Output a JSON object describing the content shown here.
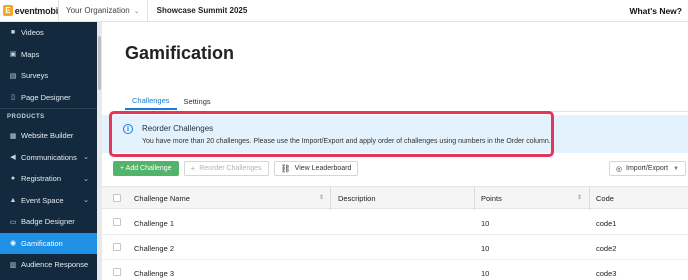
{
  "topbar": {
    "logo_text": "eventmobi",
    "org_label": "Your Organization",
    "event_name": "Showcase Summit 2025",
    "whats_new": "What's New?"
  },
  "sidebar": {
    "items_top": [
      {
        "label": "Videos",
        "icon": "video-icon"
      },
      {
        "label": "Maps",
        "icon": "map-icon"
      },
      {
        "label": "Surveys",
        "icon": "survey-icon"
      },
      {
        "label": "Page Designer",
        "icon": "page-icon"
      }
    ],
    "section_label": "PRODUCTS",
    "items_products": [
      {
        "label": "Website Builder",
        "icon": "website-icon",
        "expandable": false
      },
      {
        "label": "Communications",
        "icon": "megaphone-icon",
        "expandable": true
      },
      {
        "label": "Registration",
        "icon": "person-icon",
        "expandable": true
      },
      {
        "label": "Event Space",
        "icon": "event-space-icon",
        "expandable": true
      },
      {
        "label": "Badge Designer",
        "icon": "badge-icon",
        "expandable": false
      },
      {
        "label": "Gamification",
        "icon": "gamepad-icon",
        "expandable": false,
        "active": true
      },
      {
        "label": "Audience Response",
        "icon": "chart-icon",
        "expandable": false
      }
    ],
    "active_color": "#1e90e6",
    "bg_color": "#132a3e"
  },
  "main": {
    "title": "Gamification",
    "tabs": [
      {
        "label": "Challenges",
        "active": true
      },
      {
        "label": "Settings",
        "active": false
      }
    ],
    "banner": {
      "title": "Reorder Challenges",
      "text": "You have more than 20 challenges. Please use the Import/Export and apply order of challenges using numbers in the Order column."
    },
    "actions": {
      "add_challenge": "+ Add Challenge",
      "reorder_challenges": "Reorder Challenges",
      "view_leaderboard": "View Leaderboard",
      "import_export": "Import/Export"
    },
    "table": {
      "columns": [
        "Challenge Name",
        "Description",
        "Points",
        "Code"
      ],
      "rows": [
        {
          "name": "Challenge 1",
          "description": "",
          "points": "10",
          "code": "code1"
        },
        {
          "name": "Challenge 2",
          "description": "",
          "points": "10",
          "code": "code2"
        },
        {
          "name": "Challenge 3",
          "description": "",
          "points": "10",
          "code": "code3"
        }
      ]
    },
    "accent_color": "#1e7bd0",
    "primary_button_color": "#52b36a",
    "highlight_color": "#e5355a"
  }
}
